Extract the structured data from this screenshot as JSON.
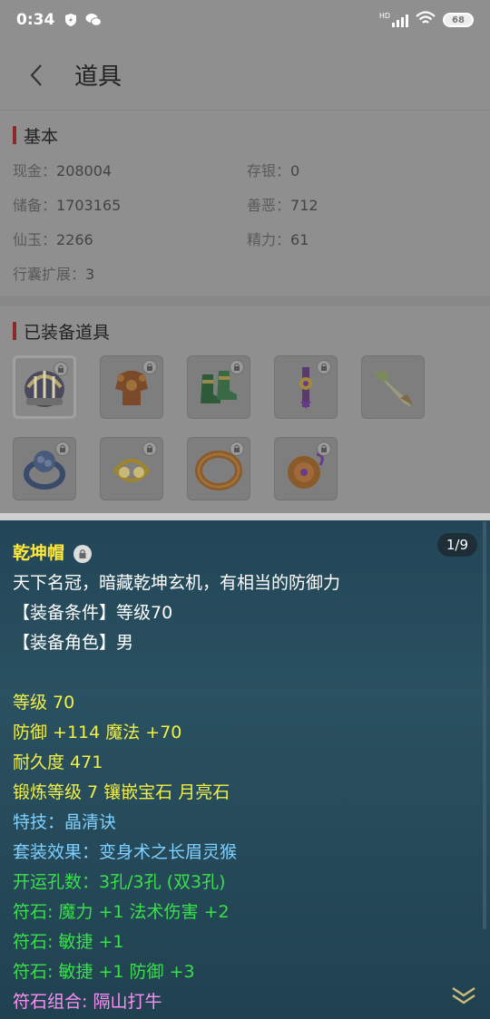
{
  "status_bar": {
    "time": "0:34",
    "battery": "68",
    "network_label": "HD"
  },
  "header": {
    "title": "道具"
  },
  "basic": {
    "title": "基本",
    "fields": [
      {
        "key": "现金：",
        "value": "208004"
      },
      {
        "key": "存银：",
        "value": "0"
      },
      {
        "key": "储备：",
        "value": "1703165"
      },
      {
        "key": "善恶：",
        "value": "712"
      },
      {
        "key": "仙玉：",
        "value": "2266"
      },
      {
        "key": "精力：",
        "value": "61"
      },
      {
        "key": "行囊扩展：",
        "value": "3"
      }
    ]
  },
  "equipped": {
    "title": "已装备道具",
    "items": [
      {
        "icon": "helmet-icon"
      },
      {
        "icon": "armor-icon"
      },
      {
        "icon": "boots-icon"
      },
      {
        "icon": "belt-icon"
      },
      {
        "icon": "weapon-icon"
      },
      {
        "icon": "ring-icon"
      },
      {
        "icon": "earring-icon"
      },
      {
        "icon": "bracelet-icon"
      },
      {
        "icon": "pendant-icon"
      }
    ]
  },
  "tooltip": {
    "name": "乾坤帽",
    "page": "1/9",
    "desc": "天下名冠，暗藏乾坤玄机，有相当的防御力",
    "req_level": "【装备条件】等级70",
    "req_role": "【装备角色】男",
    "level": "等级 70",
    "defense": "防御 +114 魔法 +70",
    "durability": "耐久度 471",
    "forge": "锻炼等级 7 镶嵌宝石 月亮石",
    "skill": "特技：晶清诀",
    "set": "套装效果：变身术之长眉灵猴",
    "holes": "开运孔数：3孔/3孔 (双3孔)",
    "rune1": "符石: 魔力 +1 法术伤害 +2",
    "rune2": "符石: 敏捷 +1",
    "rune3": "符石: 敏捷 +1 防御 +3",
    "rune_combo": "符石组合: 隔山打牛"
  },
  "colors": {
    "title_yellow": "#ffe93a",
    "stat_yellow": "#f3f044",
    "skill_blue": "#7fd0ff",
    "rune_green": "#39e04a",
    "combo_pink": "#ff8ff5",
    "panel_bg": "#2a5161"
  }
}
